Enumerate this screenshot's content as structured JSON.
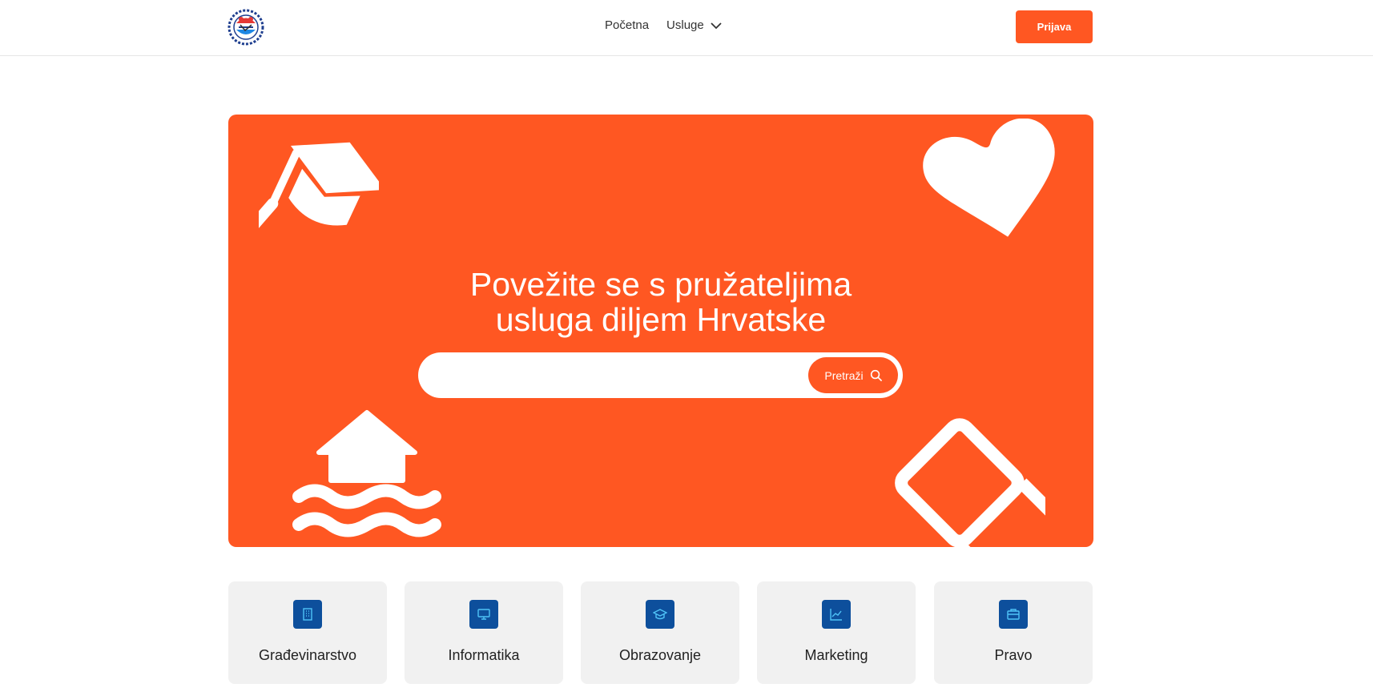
{
  "header": {
    "logo_icon": "crest-logo-icon",
    "nav": [
      {
        "label": "Početna"
      },
      {
        "label": "Usluge",
        "icon": "chevron-down-icon"
      }
    ],
    "login_label": "Prijava"
  },
  "hero": {
    "title_line1": "Povežite se s pružateljima",
    "title_line2": "usluga diljem Hrvatske",
    "search": {
      "value": "",
      "placeholder": "",
      "button_label": "Pretraži",
      "button_icon": "search-icon"
    },
    "background_color": "#ff5722",
    "decorations": [
      "graduation-cap-icon",
      "heart-icon",
      "flooded-house-icon",
      "eraser-icon"
    ]
  },
  "categories": [
    {
      "label": "Građevinarstvo",
      "icon": "building-icon"
    },
    {
      "label": "Informatika",
      "icon": "monitor-icon"
    },
    {
      "label": "Obrazovanje",
      "icon": "graduation-cap-icon"
    },
    {
      "label": "Marketing",
      "icon": "chart-icon"
    },
    {
      "label": "Pravo",
      "icon": "briefcase-icon"
    }
  ],
  "colors": {
    "accent": "#ff5722",
    "icon_bg": "#0d4f9c",
    "card_bg": "#f1f1f1"
  }
}
